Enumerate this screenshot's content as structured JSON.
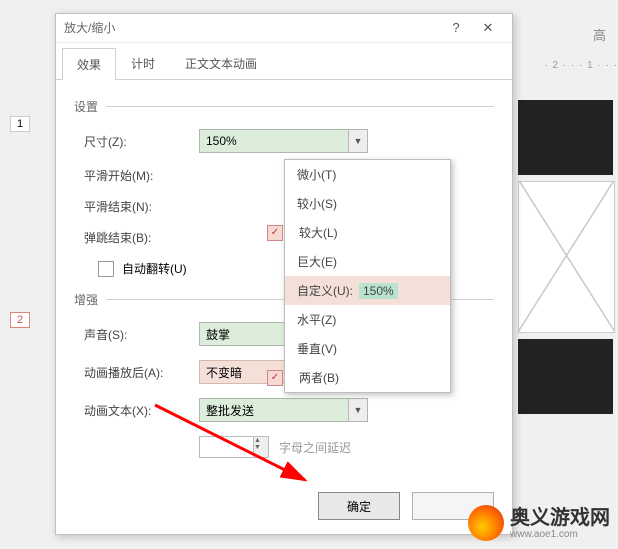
{
  "bg": {
    "hint": "高",
    "ruler": "· 2 · · · 1 · · ·"
  },
  "slides": {
    "n1": "1",
    "n2": "2"
  },
  "dialog": {
    "title": "放大/缩小",
    "tabs": {
      "effect": "效果",
      "timing": "计时",
      "textanim": "正文文本动画"
    },
    "sections": {
      "settings": "设置",
      "enhance": "增强"
    },
    "size": {
      "label": "尺寸(Z):",
      "value": "150%"
    },
    "smoothstart": {
      "label": "平滑开始(M):"
    },
    "smoothend": {
      "label": "平滑结束(N):"
    },
    "bounceend": {
      "label": "弹跳结束(B):"
    },
    "autoreverse": {
      "label": "自动翻转(U)"
    },
    "sound": {
      "label": "声音(S):",
      "value": "鼓掌"
    },
    "afterplay": {
      "label": "动画播放后(A):",
      "value": "不变暗"
    },
    "animtext": {
      "label": "动画文本(X):",
      "value": "整批发送"
    },
    "letterdelay": {
      "hint": "字母之间延迟"
    },
    "buttons": {
      "ok": "确定"
    }
  },
  "dropdown": {
    "tiny": "微小(T)",
    "smaller": "较小(S)",
    "larger": "较大(L)",
    "huge": "巨大(E)",
    "custom_label": "自定义(U):",
    "custom_value": "150%",
    "horiz": "水平(Z)",
    "vert": "垂直(V)",
    "both": "两者(B)"
  },
  "logo": {
    "name": "奥义游戏网",
    "url": "www.aoe1.com"
  }
}
